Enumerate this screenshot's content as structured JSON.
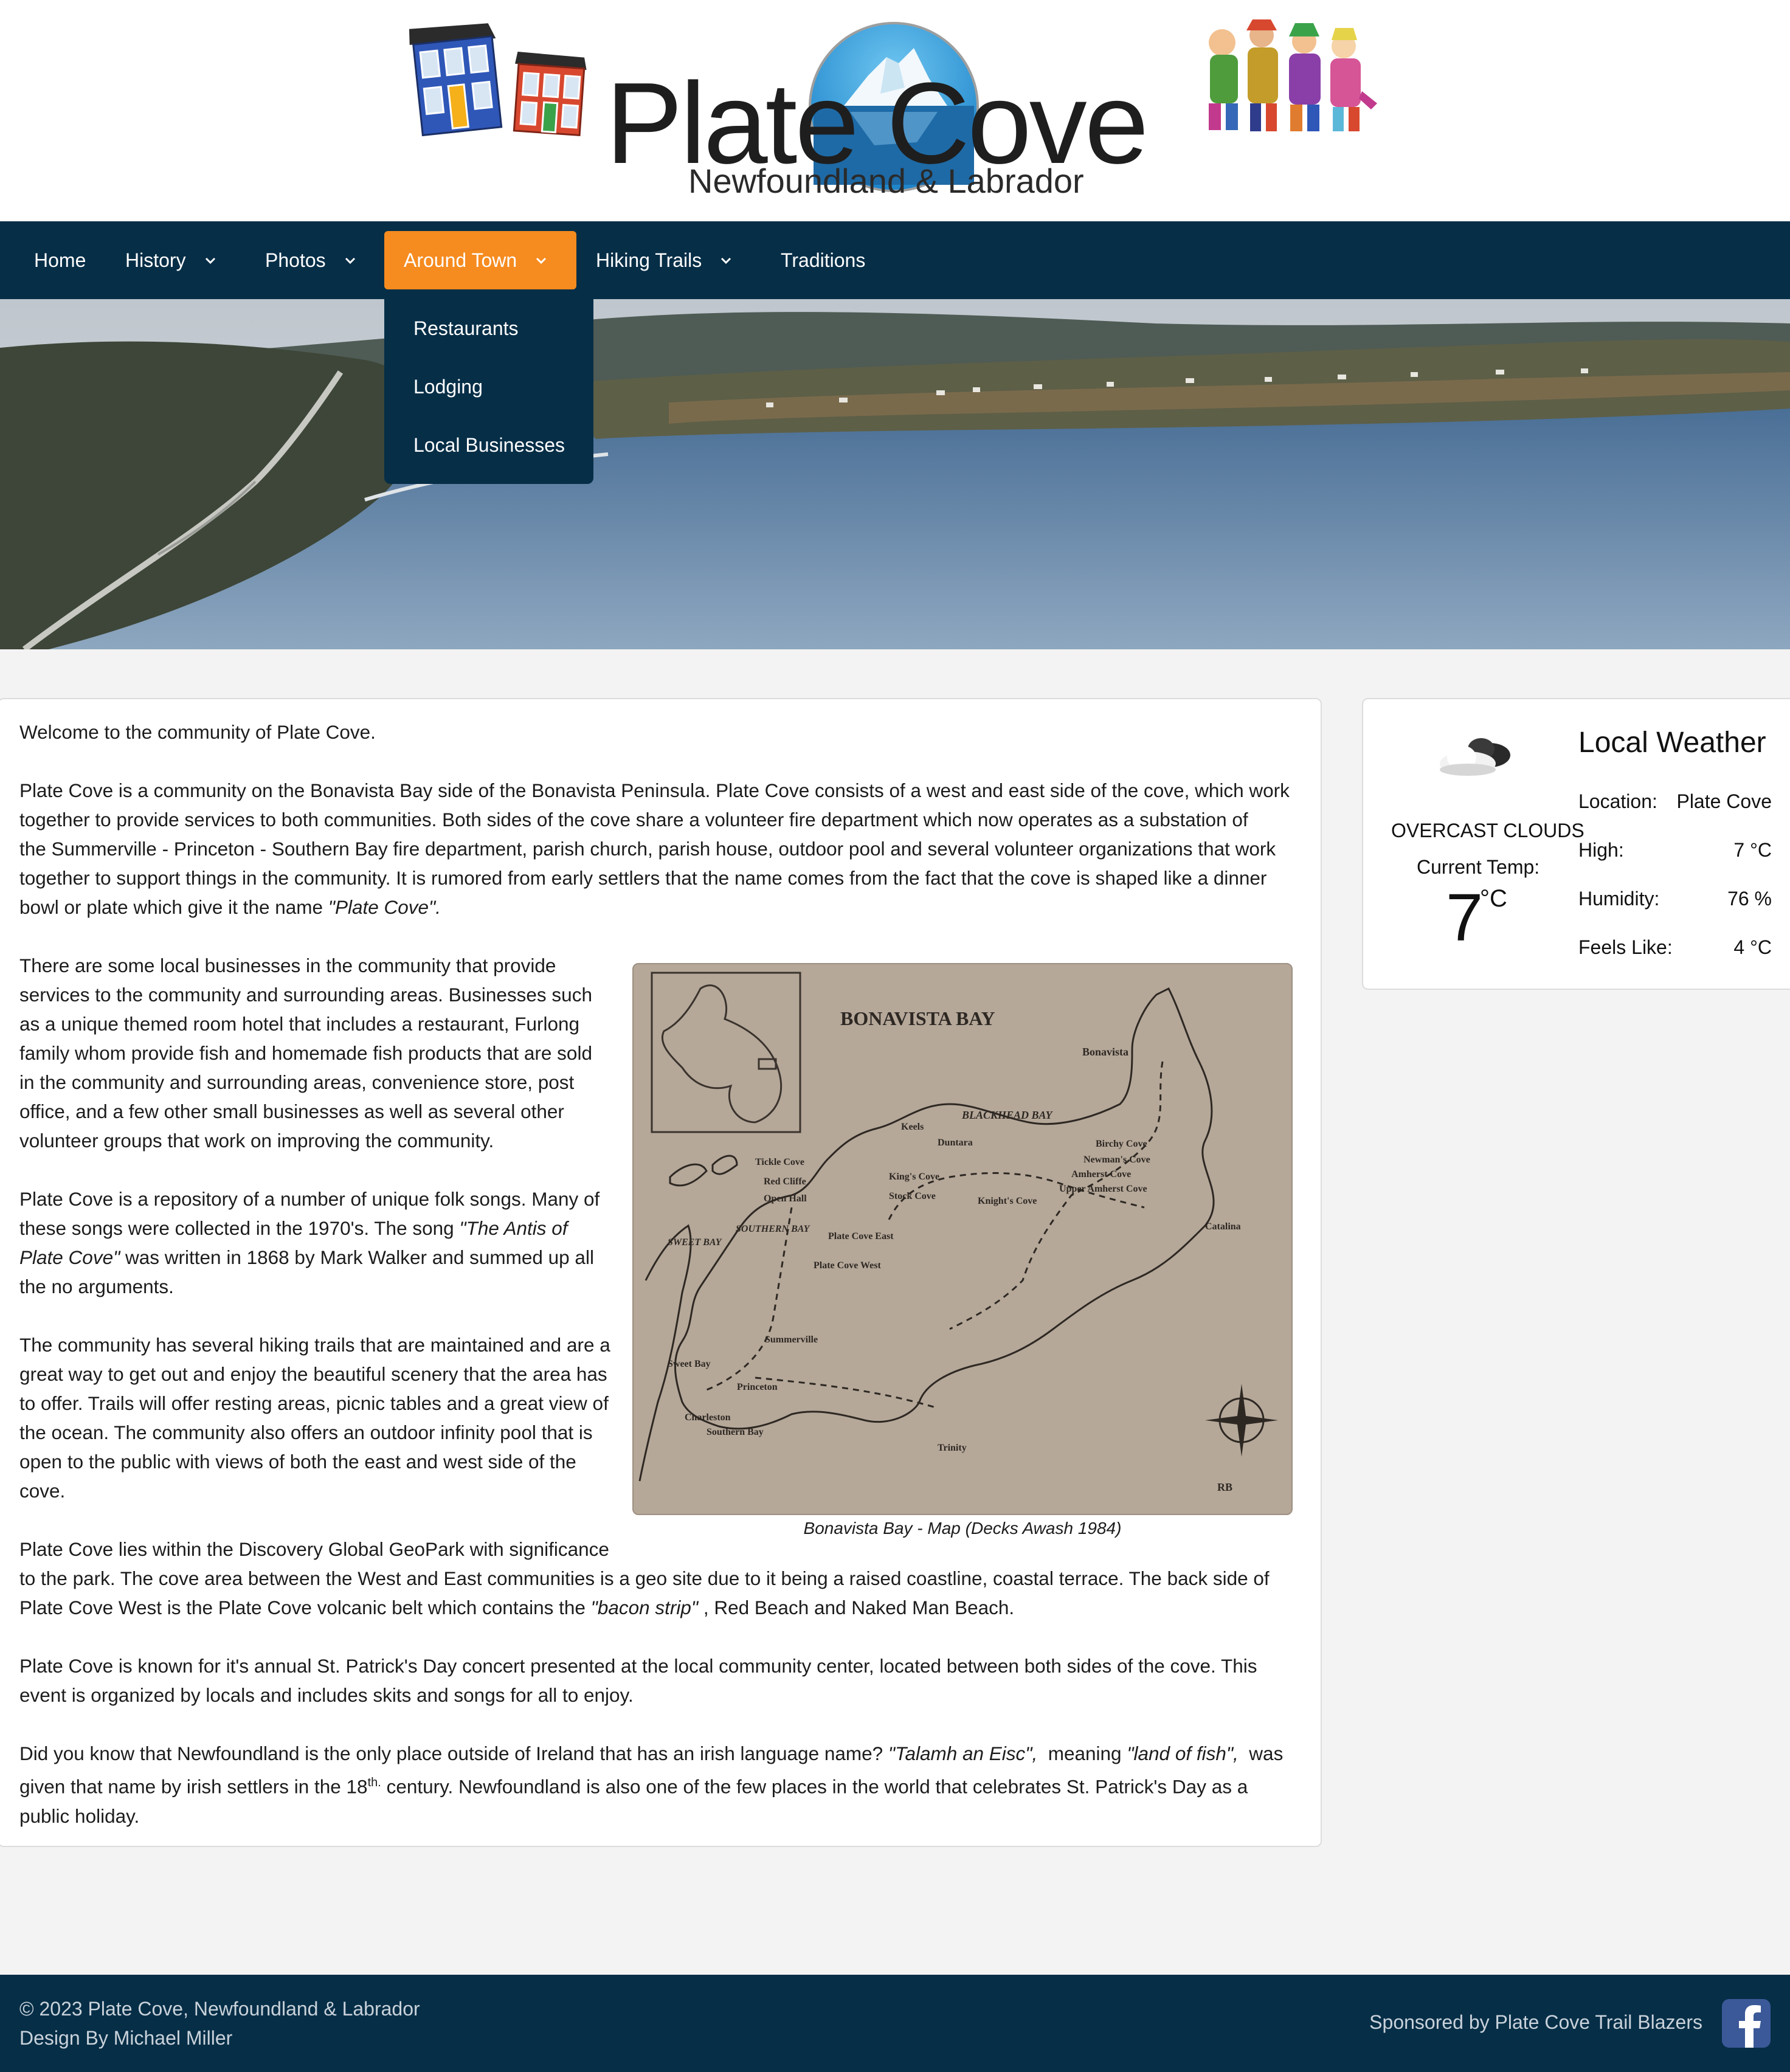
{
  "site": {
    "title": "Plate Cove",
    "subtitle": "Newfoundland & Labrador"
  },
  "nav": {
    "items": [
      {
        "label": "Home"
      },
      {
        "label": "History"
      },
      {
        "label": "Photos"
      },
      {
        "label": "Around Town"
      },
      {
        "label": "Hiking Trails"
      },
      {
        "label": "Traditions"
      }
    ],
    "active": "Around Town",
    "dropdown": [
      "Restaurants",
      "Lodging",
      "Local Businesses"
    ]
  },
  "content": {
    "welcome": "Welcome to the community of Plate Cove.",
    "p1": [
      "Plate Cove is a community on the Bonavista Bay side of the Bonavista Peninsula. Plate Cove consists of a west and east side of the cove, which work",
      "together to provide services to both communities. Both sides of the cove share a volunteer fire department which now operates as a substation of",
      "the Summerville - Princeton - Southern Bay fire department, parish church, parish house, outdoor pool and several volunteer organizations that work",
      "together to support things in the community. It is rumored from early settlers that the name comes from the fact that the cove is shaped like a dinner",
      "bowl or plate which give it the name "
    ],
    "p1_em": "\"Plate Cove\".",
    "p2": [
      "There are some local businesses in the community that provide",
      "services to the community and surrounding areas. Businesses such",
      "as a unique themed room hotel that includes a restaurant, Furlong",
      "family whom provide fish and homemade fish products that are sold",
      "in the community and surrounding areas, convenience store, post",
      "office, and a few other small businesses as well as several other",
      "volunteer groups that work on improving the community."
    ],
    "p3_a": "Plate Cove is a repository of a number of unique folk songs. Many of",
    "p3_b": "these songs were collected in the 1970's. The song ",
    "p3_em1": "\"The Antis of",
    "p3_em2": "Plate Cove\"",
    "p3_c": " was written in 1868 by Mark Walker and summed up all",
    "p3_d": "the no arguments.",
    "p4": [
      "The community has several hiking trails that are maintained and are a",
      "great way to get out and enjoy the beautiful scenery that the area has",
      "to offer. Trails will offer resting areas, picnic tables and a great view of",
      "the ocean. The community also offers an outdoor infinity pool that is",
      "open to the public with views of both the east and west side of the",
      "cove."
    ],
    "p5_a": "Plate Cove lies within the Discovery Global GeoPark with significance",
    "p5_b": "to the park. The cove area between the West and East communities is a geo site due to it being a raised coastline, coastal terrace. The back side of",
    "p5_c": "Plate Cove West is the Plate Cove volcanic belt which contains the ",
    "p5_em": "\"bacon strip\"",
    "p5_d": " , Red Beach and Naked Man Beach.",
    "p6": [
      "Plate Cove is known for it's annual St. Patrick's Day concert presented at the local community center, located between both sides of the cove. This",
      "event is organized by locals and includes skits and songs for all to enjoy."
    ],
    "p7_a": "Did you know that Newfoundland is the only place outside of Ireland that has an irish language name? ",
    "p7_em1": "\"Talamh an Eisc\",",
    "p7_b": "  meaning ",
    "p7_em2": "\"land of fish\",",
    "p7_c": "  was",
    "p7_d": "given that name by irish settlers in the 18",
    "p7_sup": "th.",
    "p7_e": " century. Newfoundland is also one of the few places in the world that celebrates St. Patrick's Day as a",
    "p7_f": "public holiday.",
    "map_caption": "Bonavista Bay - Map (Decks Awash 1984)"
  },
  "map": {
    "title": "BONAVISTA BAY",
    "places": [
      "Bonavista",
      "BLACKHEAD BAY",
      "Keels",
      "Duntara",
      "Birchy Cove",
      "Newman's Cove",
      "Amherst Cove",
      "Upper Amherst Cove",
      "Tickle Cove",
      "Red Cliffe",
      "Open Hall",
      "King's Cove",
      "Stock Cove",
      "Knight's Cove",
      "SOUTHERN BAY",
      "Plate Cove East",
      "Plate Cove West",
      "SWEET BAY",
      "Catalina",
      "Summerville",
      "Sweet Bay",
      "Princeton",
      "Charleston",
      "Southern Bay",
      "Trinity",
      "RB"
    ]
  },
  "weather": {
    "title": "Local Weather",
    "condition": "OVERCAST CLOUDS",
    "current_label": "Current Temp:",
    "current_temp": "7",
    "unit": "°C",
    "rows": [
      {
        "label": "Location:",
        "value": "Plate Cove"
      },
      {
        "label": "High:",
        "value": "7 °C"
      },
      {
        "label": "Humidity:",
        "value": "76 %"
      },
      {
        "label": "Feels Like:",
        "value": "4 °C"
      }
    ],
    "icon": "cloud-icon"
  },
  "footer": {
    "copyright": "© 2023 Plate Cove, Newfoundland & Labrador",
    "design": "Design By Michael Miller",
    "sponsor": "Sponsored by Plate Cove Trail Blazers",
    "social_icon": "facebook-icon"
  },
  "colors": {
    "nav_bg": "#062e47",
    "accent": "#f68b1f",
    "footer_bg": "#062e47"
  }
}
